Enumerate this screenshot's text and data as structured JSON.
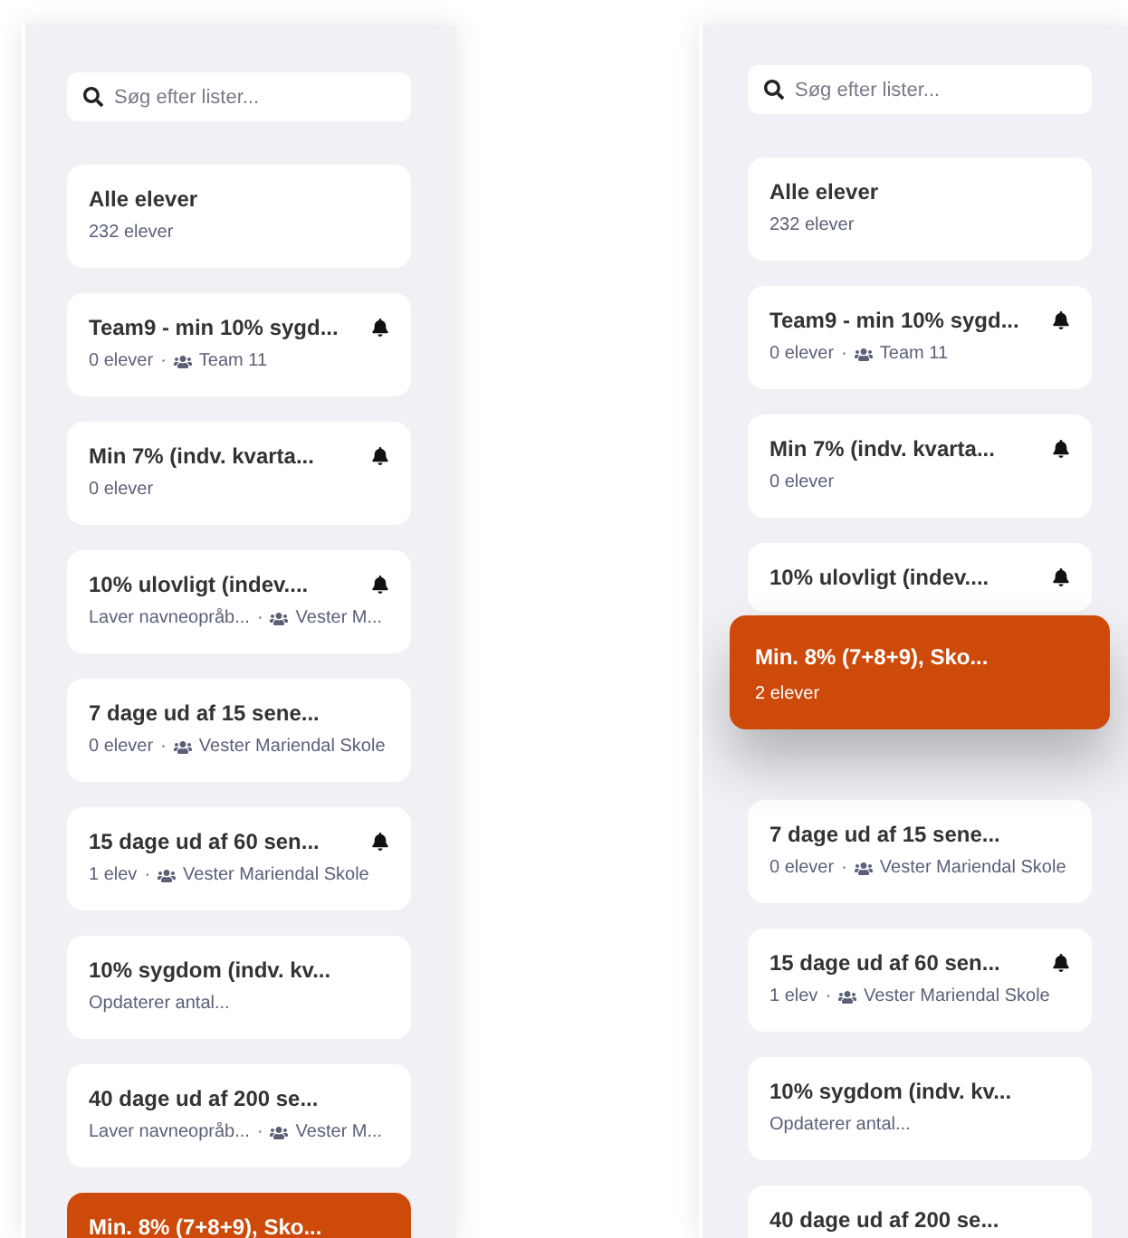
{
  "panels": [
    {
      "search": {
        "placeholder": "Søg efter lister..."
      },
      "lists": [
        {
          "kind": "list",
          "title": "Alle elever",
          "count": "232 elever",
          "alert": false,
          "selected": false
        },
        {
          "kind": "list",
          "title": "Team9 - min 10% sygd...",
          "count": "0 elever",
          "separator": "·",
          "group": "Team 11",
          "alert": true,
          "selected": false
        },
        {
          "kind": "list",
          "title": "Min 7% (indv. kvarta...",
          "count": "0 elever",
          "alert": true,
          "selected": false
        },
        {
          "kind": "list",
          "title": "10% ulovligt (indev....",
          "count": "Laver navneopråb...",
          "separator": "·",
          "group": "Vester M...",
          "alert": true,
          "selected": false
        },
        {
          "kind": "list",
          "title": "7 dage ud af 15 sene...",
          "count": "0 elever",
          "separator": "·",
          "group": "Vester Mariendal Skole",
          "alert": false,
          "selected": false
        },
        {
          "kind": "list",
          "title": "15 dage ud af 60 sen...",
          "count": "1 elev",
          "separator": "·",
          "group": "Vester Mariendal Skole",
          "alert": true,
          "selected": false
        },
        {
          "kind": "list",
          "title": "10% sygdom (indv. kv...",
          "count": "Opdaterer antal...",
          "alert": false,
          "selected": false
        },
        {
          "kind": "list",
          "title": "40 dage ud af 200 se...",
          "count": "Laver navneopråb...",
          "separator": "·",
          "group": "Vester M...",
          "alert": false,
          "selected": false
        },
        {
          "kind": "list",
          "title": "Min. 8% (7+8+9), Sko...",
          "alert": false,
          "selected": true
        }
      ]
    },
    {
      "search": {
        "placeholder": "Søg efter lister..."
      },
      "lists": [
        {
          "kind": "list",
          "title": "Alle elever",
          "count": "232 elever",
          "alert": false,
          "selected": false
        },
        {
          "kind": "list",
          "title": "Team9 - min 10% sygd...",
          "count": "0 elever",
          "separator": "·",
          "group": "Team 11",
          "alert": true,
          "selected": false
        },
        {
          "kind": "list",
          "title": "Min 7% (indv. kvarta...",
          "count": "0 elever",
          "alert": true,
          "selected": false
        },
        {
          "kind": "list",
          "title": "10% ulovligt (indev....",
          "alert": true,
          "selected": false,
          "covered": true
        },
        {
          "kind": "placeholder"
        },
        {
          "kind": "list",
          "title": "7 dage ud af 15 sene...",
          "count": "0 elever",
          "separator": "·",
          "group": "Vester Mariendal Skole",
          "alert": false,
          "selected": false
        },
        {
          "kind": "list",
          "title": "15 dage ud af 60 sen...",
          "count": "1 elev",
          "separator": "·",
          "group": "Vester Mariendal Skole",
          "alert": true,
          "selected": false
        },
        {
          "kind": "list",
          "title": "10% sygdom (indv. kv...",
          "count": "Opdaterer antal...",
          "alert": false,
          "selected": false
        },
        {
          "kind": "list",
          "title": "40 dage ud af 200 se...",
          "alert": false,
          "selected": false
        }
      ],
      "dragging": {
        "title": "Min. 8% (7+8+9), Sko...",
        "count": "2 elever",
        "selected": true
      }
    }
  ]
}
